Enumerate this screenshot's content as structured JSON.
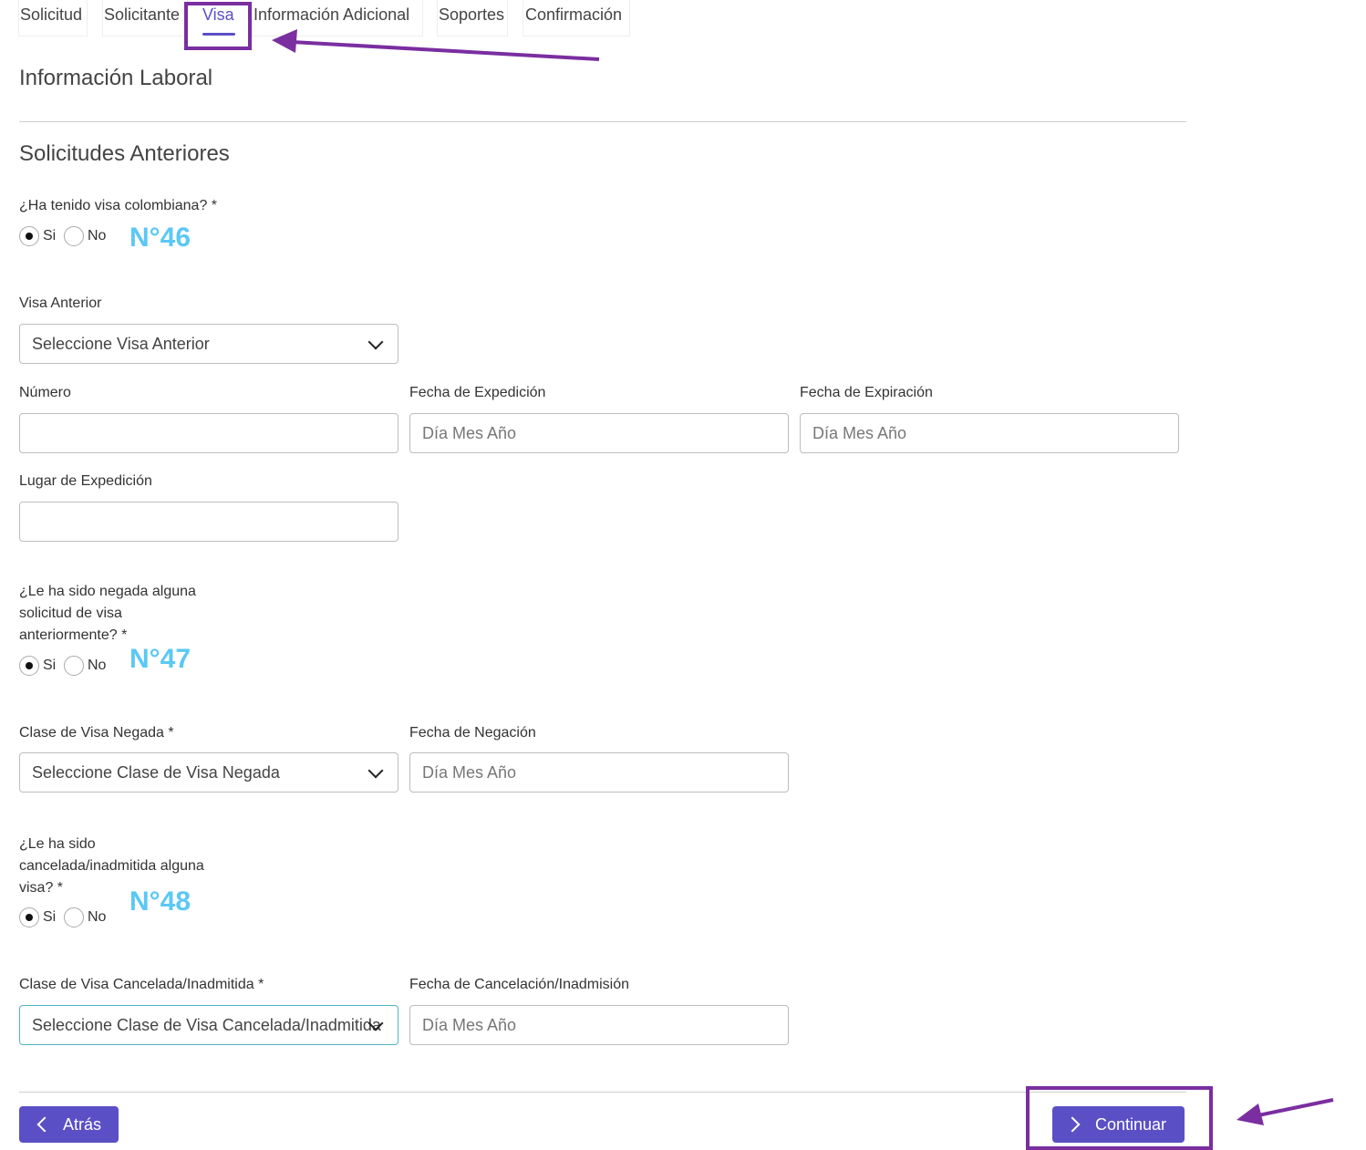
{
  "tabs": [
    {
      "label": "Solicitud"
    },
    {
      "label": "Solicitante"
    },
    {
      "label": "Visa"
    },
    {
      "label": "Información Adicional"
    },
    {
      "label": "Soportes"
    },
    {
      "label": "Confirmación"
    }
  ],
  "sections": {
    "work_info": "Información Laboral",
    "previous_applications": "Solicitudes Anteriores"
  },
  "q_visa": {
    "label": "¿Ha tenido visa colombiana? *",
    "yes": "Si",
    "no": "No",
    "selected": "Si",
    "badge": "N°46"
  },
  "prev_visa": {
    "label": "Visa Anterior",
    "value": "Seleccione Visa Anterior"
  },
  "numero": {
    "label": "Número",
    "value": ""
  },
  "fecha_expedicion": {
    "label": "Fecha de Expedición",
    "placeholder": "Día Mes Año"
  },
  "fecha_expiracion": {
    "label": "Fecha de Expiración",
    "placeholder": "Día Mes Año"
  },
  "lugar_expedicion": {
    "label": "Lugar de Expedición",
    "value": ""
  },
  "q_denied": {
    "label_lines": [
      "¿Le ha sido negada alguna",
      "solicitud de visa",
      "anteriormente? *"
    ],
    "yes": "Si",
    "no": "No",
    "selected": "Si",
    "badge": "N°47"
  },
  "denied_class": {
    "label": "Clase de Visa Negada *",
    "value": "Seleccione Clase de Visa Negada"
  },
  "denied_date": {
    "label": "Fecha de Negación",
    "placeholder": "Día Mes Año"
  },
  "q_cancelled": {
    "label_lines": [
      "¿Le ha sido",
      "cancelada/inadmitida alguna",
      "visa? *"
    ],
    "yes": "Si",
    "no": "No",
    "selected": "Si",
    "badge": "N°48"
  },
  "cancelled_class": {
    "label": "Clase de Visa Cancelada/Inadmitida *",
    "value": "Seleccione Clase de Visa Cancelada/Inadmitida"
  },
  "cancelled_date": {
    "label": "Fecha de Cancelación/Inadmisión",
    "placeholder": "Día Mes Año"
  },
  "buttons": {
    "back": "Atrás",
    "continue": "Continuar"
  },
  "colors": {
    "accent": "#5b4fc6",
    "annotation": "#7a2ea0",
    "badge": "#5bc8f5"
  }
}
